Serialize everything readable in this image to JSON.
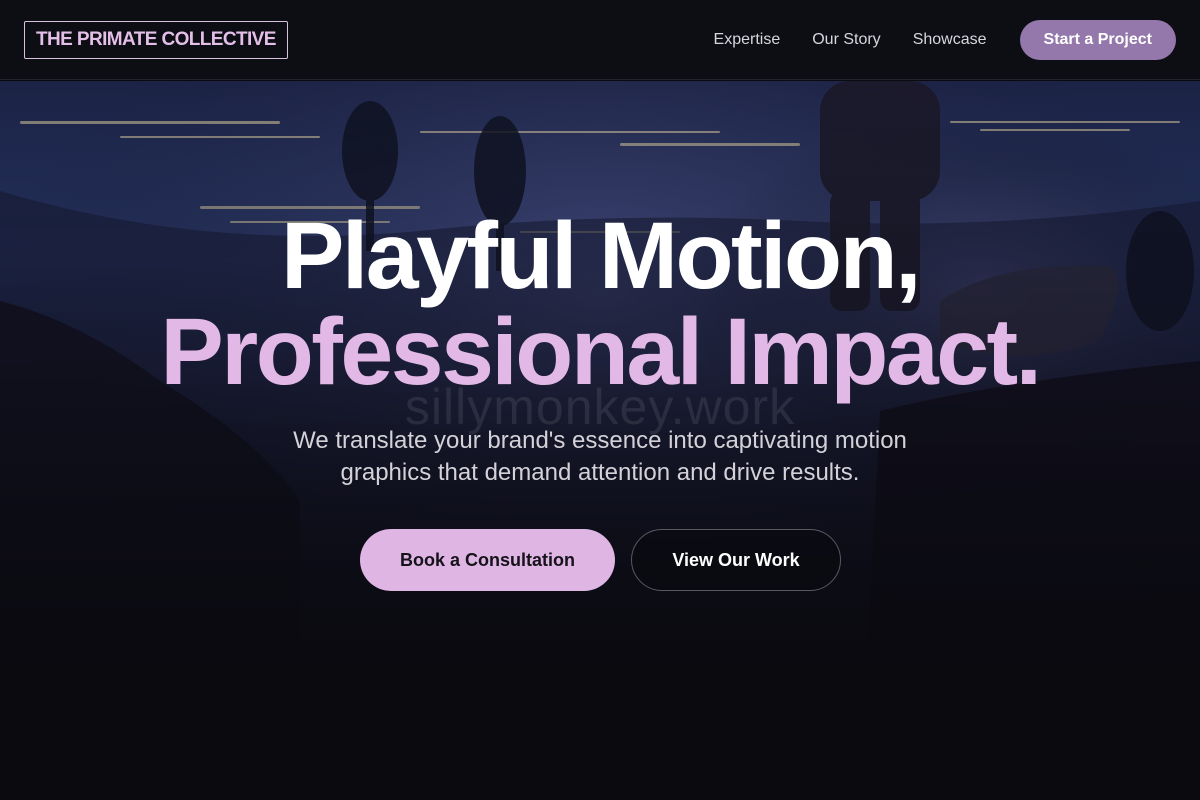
{
  "header": {
    "logo_text": "THE PRIMATE COLLECTIVE",
    "nav": [
      {
        "label": "Expertise"
      },
      {
        "label": "Our Story"
      },
      {
        "label": "Showcase"
      }
    ],
    "cta_label": "Start a Project"
  },
  "hero": {
    "headline_line1": "Playful Motion,",
    "headline_line2": "Professional Impact.",
    "watermark": "sillymonkey.work",
    "subtitle": "We translate your brand's essence into captivating motion graphics that demand attention and drive results.",
    "primary_button": "Book a Consultation",
    "secondary_button": "View Our Work"
  },
  "colors": {
    "accent": "#dfb5e4",
    "cta": "#9478ab",
    "background": "#0b0a0f"
  }
}
